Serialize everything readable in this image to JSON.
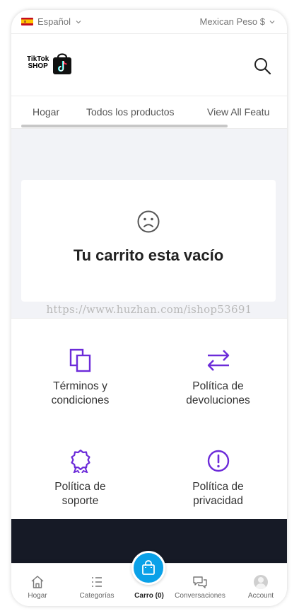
{
  "topbar": {
    "language": "Español",
    "currency": "Mexican Peso $"
  },
  "header": {
    "logo_line1": "TikTok",
    "logo_line2": "SHOP"
  },
  "tabs": [
    "Hogar",
    "Todos los productos",
    "View All Featu"
  ],
  "cart": {
    "empty_message": "Tu carrito esta vacío",
    "watermark": "https://www.huzhan.com/ishop53691"
  },
  "policies": [
    {
      "icon": "documents-icon",
      "label_line1": "Términos y",
      "label_line2": "condiciones"
    },
    {
      "icon": "swap-arrows-icon",
      "label_line1": "Política de",
      "label_line2": "devoluciones"
    },
    {
      "icon": "award-ribbon-icon",
      "label_line1": "Política de",
      "label_line2": "soporte"
    },
    {
      "icon": "alert-circle-icon",
      "label_line1": "Política de",
      "label_line2": "privacidad"
    }
  ],
  "bottom_nav": [
    {
      "icon": "home-icon",
      "label": "Hogar"
    },
    {
      "icon": "list-icon",
      "label": "Categorías"
    },
    {
      "icon": "shopping-bag-icon",
      "label": "Carro (0)"
    },
    {
      "icon": "chat-icon",
      "label": "Conversaciones"
    },
    {
      "icon": "avatar-icon",
      "label": "Account"
    }
  ],
  "colors": {
    "accent_purple": "#6c2bd9",
    "cart_blue": "#0aa1e8",
    "dark_band": "#161a26",
    "page_bg": "#f2f3f7"
  }
}
